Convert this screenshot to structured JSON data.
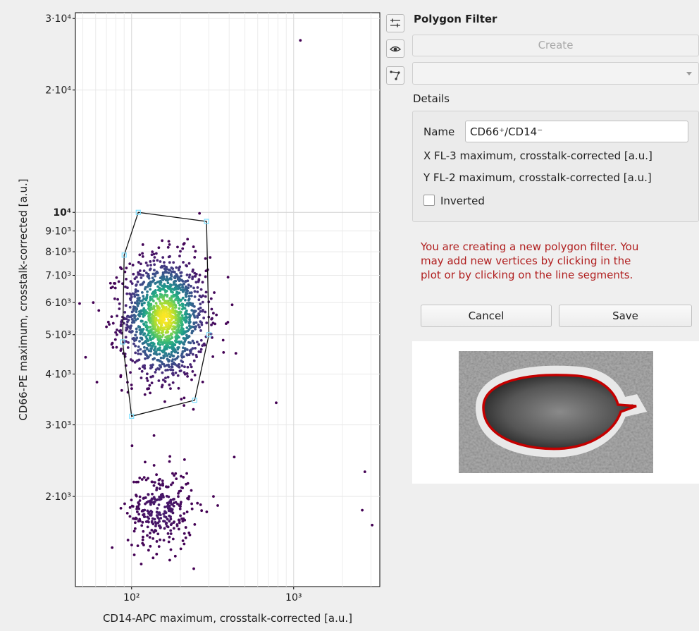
{
  "chart_data": {
    "type": "scatter",
    "xlabel": "CD14-APC maximum, crosstalk-corrected [a.u.]",
    "ylabel": "CD66-PE maximum, crosstalk-corrected [a.u.]",
    "x_scale": "log",
    "y_scale": "log",
    "xlim": [
      45,
      3400
    ],
    "ylim": [
      1200,
      31000
    ],
    "x_ticks": [
      {
        "value": 100,
        "label": "10²"
      },
      {
        "value": 1000,
        "label": "10³"
      }
    ],
    "y_ticks": [
      {
        "value": 30000,
        "label": "3·10⁴"
      },
      {
        "value": 20000,
        "label": "2·10⁴"
      },
      {
        "value": 10000,
        "label": "10⁴"
      },
      {
        "value": 9000,
        "label": "9·10³"
      },
      {
        "value": 8000,
        "label": "8·10³"
      },
      {
        "value": 7000,
        "label": "7·10³"
      },
      {
        "value": 6000,
        "label": "6·10³"
      },
      {
        "value": 5000,
        "label": "5·10³"
      },
      {
        "value": 4000,
        "label": "4·10³"
      },
      {
        "value": 3000,
        "label": "3·10³"
      },
      {
        "value": 2000,
        "label": "2·10³"
      }
    ],
    "grid": true,
    "colormap": "viridis (point density)",
    "clusters": [
      {
        "center": [
          160,
          5500
        ],
        "spread_log10": [
          0.13,
          0.075
        ],
        "count": 1400
      },
      {
        "center": [
          150,
          1850
        ],
        "spread_log10": [
          0.1,
          0.05
        ],
        "count": 300
      }
    ],
    "outliers": [
      [
        1100,
        26500
      ],
      [
        3050,
        1700
      ],
      [
        2650,
        1850
      ],
      [
        2750,
        2300
      ],
      [
        780,
        3400
      ],
      [
        440,
        4500
      ],
      [
        430,
        2500
      ],
      [
        52,
        4400
      ],
      [
        58,
        6000
      ],
      [
        320,
        2000
      ],
      [
        340,
        1900
      ]
    ],
    "polygon": [
      [
        100,
        3150
      ],
      [
        88,
        4800
      ],
      [
        90,
        7850
      ],
      [
        110,
        10000
      ],
      [
        290,
        9500
      ],
      [
        300,
        5000
      ],
      [
        245,
        3450
      ]
    ]
  },
  "colors": {
    "point_low": "#440154",
    "point_high": "#fde725",
    "polygon_line": "#111111",
    "vertex": "#7fe0ff",
    "message": "#b01e1e",
    "contour": "#c40000"
  },
  "panel": {
    "title": "Polygon Filter",
    "create_label": "Create",
    "select_value": "",
    "details_title": "Details",
    "name_label": "Name",
    "name_value": "CD66⁺/CD14⁻",
    "x_text": "X  FL-3 maximum, crosstalk-corrected [a.u.]",
    "y_text": "Y  FL-2 maximum, crosstalk-corrected [a.u.]",
    "inverted_label": "Inverted",
    "inverted_checked": false,
    "message": "You are creating a new polygon filter. You may add new vertices by clicking in the plot or by clicking on the line segments.",
    "cancel_label": "Cancel",
    "save_label": "Save"
  },
  "icons": [
    "sliders-icon",
    "eye-icon",
    "polygon-icon"
  ]
}
